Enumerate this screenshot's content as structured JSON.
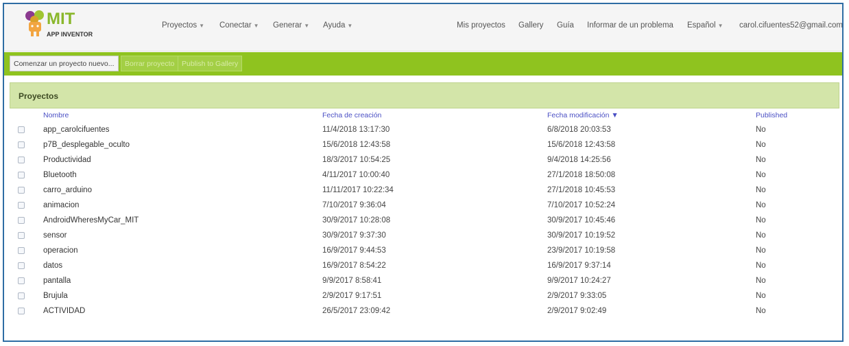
{
  "brand": {
    "mit": "MIT",
    "subtitle": "APP INVENTOR"
  },
  "menus": {
    "left": [
      "Proyectos",
      "Conectar",
      "Generar",
      "Ayuda"
    ],
    "right": {
      "my_projects": "Mis proyectos",
      "gallery": "Gallery",
      "guide": "Guía",
      "report": "Informar de un problema",
      "language": "Español",
      "account": "carol.cifuentes52@gmail.com"
    }
  },
  "toolbar": {
    "new_project": "Comenzar un proyecto nuevo...",
    "delete_project": "Borrar proyecto",
    "publish": "Publish to Gallery"
  },
  "panel": {
    "title": "Proyectos"
  },
  "table": {
    "headers": {
      "name": "Nombre",
      "created": "Fecha de creación",
      "modified": "Fecha modificación ▼",
      "published": "Published"
    },
    "rows": [
      {
        "name": "app_carolcifuentes",
        "created": "11/4/2018 13:17:30",
        "modified": "6/8/2018 20:03:53",
        "published": "No"
      },
      {
        "name": "p7B_desplegable_oculto",
        "created": "15/6/2018 12:43:58",
        "modified": "15/6/2018 12:43:58",
        "published": "No"
      },
      {
        "name": "Productividad",
        "created": "18/3/2017 10:54:25",
        "modified": "9/4/2018 14:25:56",
        "published": "No"
      },
      {
        "name": "Bluetooth",
        "created": "4/11/2017 10:00:40",
        "modified": "27/1/2018 18:50:08",
        "published": "No"
      },
      {
        "name": "carro_arduino",
        "created": "11/11/2017 10:22:34",
        "modified": "27/1/2018 10:45:53",
        "published": "No"
      },
      {
        "name": "animacion",
        "created": "7/10/2017 9:36:04",
        "modified": "7/10/2017 10:52:24",
        "published": "No"
      },
      {
        "name": "AndroidWheresMyCar_MIT",
        "created": "30/9/2017 10:28:08",
        "modified": "30/9/2017 10:45:46",
        "published": "No"
      },
      {
        "name": "sensor",
        "created": "30/9/2017 9:37:30",
        "modified": "30/9/2017 10:19:52",
        "published": "No"
      },
      {
        "name": "operacion",
        "created": "16/9/2017 9:44:53",
        "modified": "23/9/2017 10:19:58",
        "published": "No"
      },
      {
        "name": "datos",
        "created": "16/9/2017 8:54:22",
        "modified": "16/9/2017 9:37:14",
        "published": "No"
      },
      {
        "name": "pantalla",
        "created": "9/9/2017 8:58:41",
        "modified": "9/9/2017 10:24:27",
        "published": "No"
      },
      {
        "name": "Brujula",
        "created": "2/9/2017 9:17:51",
        "modified": "2/9/2017 9:33:05",
        "published": "No"
      },
      {
        "name": "ACTIVIDAD",
        "created": "26/5/2017 23:09:42",
        "modified": "2/9/2017 9:02:49",
        "published": "No"
      }
    ]
  },
  "colors": {
    "toolbar_green": "#8fc31f",
    "panel_header": "#d3e5a9",
    "link_blue": "#4a4fc4",
    "frame_border": "#2e6da4"
  }
}
